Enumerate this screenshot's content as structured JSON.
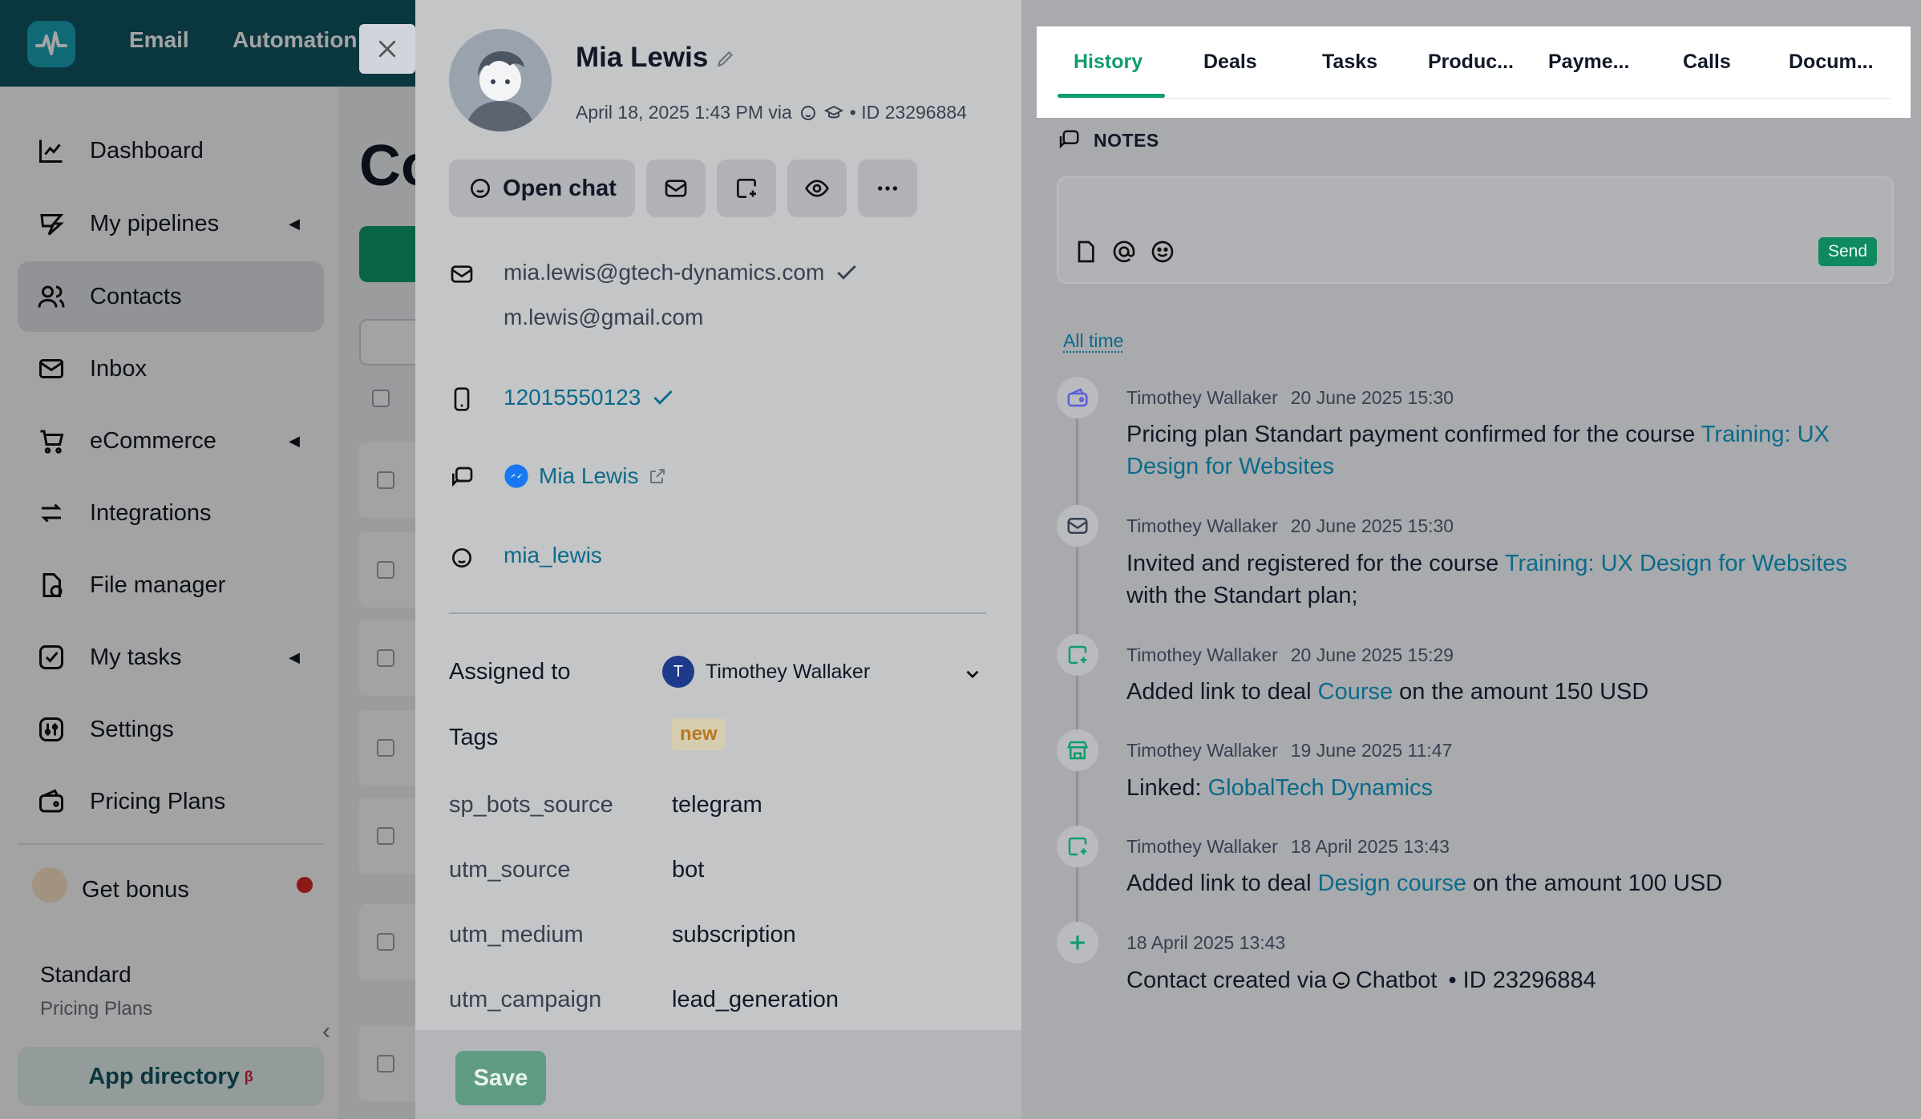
{
  "topbar": {
    "nav": [
      "Email",
      "Automation"
    ]
  },
  "sidebar": {
    "items": [
      {
        "label": "Dashboard",
        "icon": "chart-line-icon"
      },
      {
        "label": "My pipelines",
        "icon": "pipeline-icon"
      },
      {
        "label": "Contacts",
        "icon": "users-icon"
      },
      {
        "label": "Inbox",
        "icon": "inbox-icon"
      },
      {
        "label": "eCommerce",
        "icon": "cart-icon"
      },
      {
        "label": "Integrations",
        "icon": "arrows-icon"
      },
      {
        "label": "File manager",
        "icon": "file-icon"
      },
      {
        "label": "My tasks",
        "icon": "check-square-icon"
      },
      {
        "label": "Settings",
        "icon": "settings-icon"
      },
      {
        "label": "Pricing Plans",
        "icon": "wallet-icon"
      }
    ],
    "bonus": "Get bonus",
    "plan_name": "Standard",
    "plan_sub": "Pricing Plans",
    "app_directory": "App directory",
    "app_directory_sup": "β"
  },
  "content": {
    "title_fragment": "Co"
  },
  "contact": {
    "name": "Mia Lewis",
    "meta_date": "April 18, 2025 1:43 PM via",
    "meta_id": "• ID 23296884",
    "open_chat": "Open chat",
    "email_primary": "mia.lewis@gtech-dynamics.com",
    "email_secondary": "m.lewis@gmail.com",
    "phone": "12015550123",
    "messenger": "Mia Lewis",
    "username": "mia_lewis",
    "assigned_label": "Assigned to",
    "assignee": "Timothey Wallaker",
    "assignee_initial": "T",
    "tags_label": "Tags",
    "tag": "new",
    "fields": [
      {
        "label": "sp_bots_source",
        "value": "telegram"
      },
      {
        "label": "utm_source",
        "value": "bot"
      },
      {
        "label": "utm_medium",
        "value": "subscription"
      },
      {
        "label": "utm_campaign",
        "value": "lead_generation"
      }
    ],
    "save": "Save"
  },
  "tabs": [
    "History",
    "Deals",
    "Tasks",
    "Produc...",
    "Payme...",
    "Calls",
    "Docum..."
  ],
  "notes": {
    "heading": "NOTES",
    "send": "Send"
  },
  "filter": "All time",
  "history": [
    {
      "author": "Timothey Wallaker",
      "time": "20 June 2025 15:30",
      "pre": "Pricing plan Standart payment confirmed for the course ",
      "link": "Training: UX Design for Websites",
      "post": ""
    },
    {
      "author": "Timothey Wallaker",
      "time": "20 June 2025 15:30",
      "pre": "Invited and registered for the course ",
      "link": "Training: UX Design for Websites",
      "post": " with the Standart plan;"
    },
    {
      "author": "Timothey Wallaker",
      "time": "20 June 2025 15:29",
      "pre": "Added link to deal ",
      "link": "Course",
      "post": " on the amount 150 USD"
    },
    {
      "author": "Timothey Wallaker",
      "time": "19 June 2025 11:47",
      "pre": "Linked: ",
      "link": "GlobalTech Dynamics",
      "post": ""
    },
    {
      "author": "Timothey Wallaker",
      "time": "18 April 2025 13:43",
      "pre": "Added link to deal ",
      "link": "Design course",
      "post": " on the amount 100 USD"
    },
    {
      "author": "",
      "time": "18 April 2025 13:43",
      "pre": "Contact created via ",
      "link": "",
      "post": " Chatbot",
      "post_id": "• ID 23296884"
    }
  ],
  "colors": {
    "brand": "#0f5563",
    "accent": "#0f9d6e",
    "link": "#0b6b8a"
  }
}
